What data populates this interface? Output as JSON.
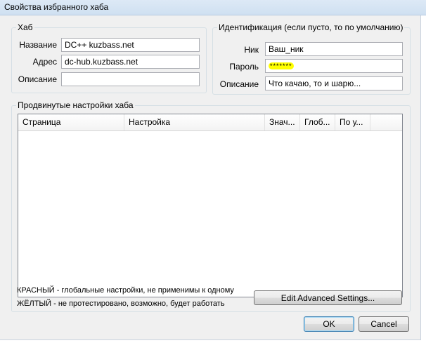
{
  "window": {
    "title": "Свойства избранного хаба"
  },
  "hub": {
    "legend": "Хаб",
    "name_label": "Название",
    "name_value": "DC++ kuzbass.net",
    "address_label": "Адрес",
    "address_value": "dc-hub.kuzbass.net",
    "description_label": "Описание",
    "description_value": ""
  },
  "identification": {
    "legend": "Идентификация (если пусто, то по умолчанию)",
    "nick_label": "Ник",
    "nick_value": "Ваш_ник",
    "password_label": "Пароль",
    "password_value": "*******",
    "description_label": "Описание",
    "description_value": "Что качаю, то и шарю..."
  },
  "advanced": {
    "legend": "Продвинутые настройки хаба",
    "columns": [
      "Страница",
      "Настройка",
      "Знач...",
      "Глоб...",
      "По у..."
    ],
    "rows": [],
    "note_red": "КРАСНЫЙ - глобальные настройки, не применимы к одному",
    "note_yellow": "ЖЁЛТЫЙ - не протестировано, возможно, будет работать",
    "edit_button": "Edit Advanced Settings..."
  },
  "buttons": {
    "ok": "OK",
    "cancel": "Cancel"
  },
  "colors": {
    "password_highlight": "#ffff00",
    "title_bar": "#dde9f6"
  }
}
